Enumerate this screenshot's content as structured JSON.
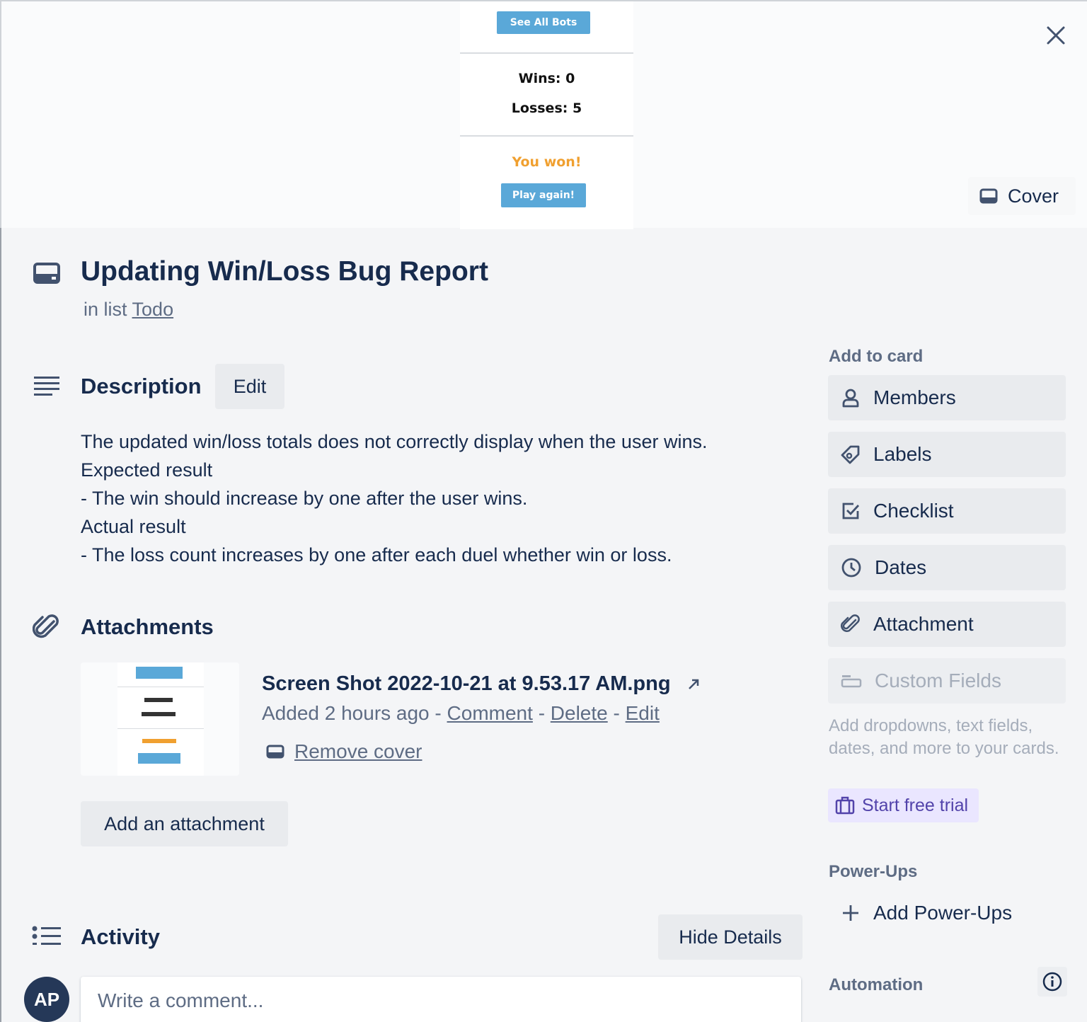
{
  "cover_image": {
    "see_all_bots": "See All Bots",
    "wins": "Wins: 0",
    "losses": "Losses: 5",
    "you_won": "You won!",
    "play_again": "Play again!"
  },
  "header": {
    "cover_label": "Cover",
    "close_icon": "close-icon"
  },
  "card": {
    "title": "Updating Win/Loss Bug Report",
    "in_list_prefix": "in list",
    "list_name": "Todo"
  },
  "description": {
    "heading": "Description",
    "edit_label": "Edit",
    "lines": [
      "The updated win/loss totals does not correctly display when the user wins.",
      "Expected result",
      "- The win should increase by one after the user wins.",
      "Actual result",
      "- The loss count increases by one after each duel whether win or loss."
    ]
  },
  "attachments": {
    "heading": "Attachments",
    "items": [
      {
        "name": "Screen Shot 2022-10-21 at 9.53.17 AM.png",
        "added": "Added 2 hours ago",
        "sep": "-",
        "comment": "Comment",
        "delete": "Delete",
        "edit": "Edit",
        "remove_cover": "Remove cover"
      }
    ],
    "add_label": "Add an attachment"
  },
  "activity": {
    "heading": "Activity",
    "hide_details": "Hide Details",
    "avatar_initials": "AP",
    "comment_placeholder": "Write a comment..."
  },
  "sidebar": {
    "add_to_card_heading": "Add to card",
    "buttons": [
      {
        "label": "Members",
        "icon": "person-icon"
      },
      {
        "label": "Labels",
        "icon": "tag-icon"
      },
      {
        "label": "Checklist",
        "icon": "checkbox-icon"
      },
      {
        "label": "Dates",
        "icon": "clock-icon"
      },
      {
        "label": "Attachment",
        "icon": "paperclip-icon"
      },
      {
        "label": "Custom Fields",
        "icon": "field-icon",
        "disabled": true
      }
    ],
    "custom_fields_note": "Add dropdowns, text fields, dates, and more to your cards.",
    "start_trial": "Start free trial",
    "powerups_heading": "Power-Ups",
    "add_powerups": "Add Power-Ups",
    "automation_heading": "Automation"
  },
  "colors": {
    "primary_text": "#172b4d",
    "subtle_text": "#5e6c84",
    "button_bg": "#e9ebee",
    "trial_bg": "#eae6ff",
    "trial_text": "#5243aa",
    "avatar_bg": "#253858",
    "cover_button_blue": "#5aa8d8",
    "you_won_orange": "#f0a030"
  }
}
